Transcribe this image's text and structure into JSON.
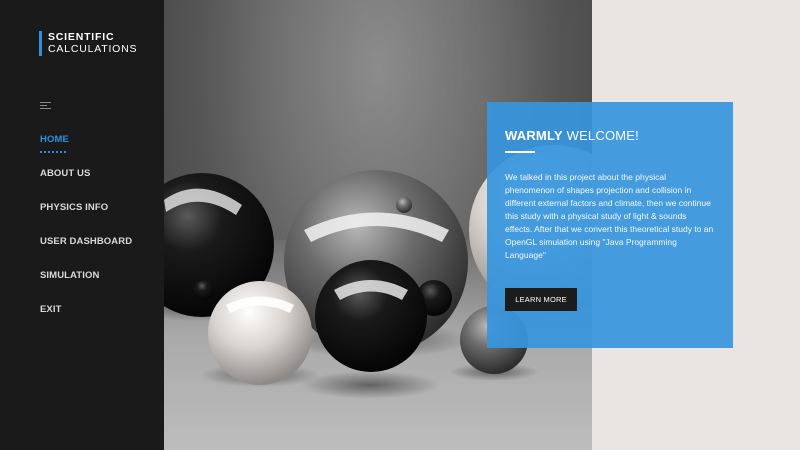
{
  "brand": {
    "line1": "SCIENTIFIC",
    "line2": "CALCULATIONS"
  },
  "nav": {
    "items": [
      {
        "label": "HOME",
        "active": true
      },
      {
        "label": "ABOUT US"
      },
      {
        "label": "PHYSICS INFO"
      },
      {
        "label": "USER DASHBOARD"
      },
      {
        "label": "SIMULATION"
      },
      {
        "label": "EXIT"
      }
    ]
  },
  "welcome": {
    "title_bold": "WARMLY",
    "title_rest": " WELCOME!",
    "body": "We talked in this project about the physical phenomenon of shapes projection and collision in different external factors and climate, then we continue this study with a physical study of light & sounds effects. After that we convert this theoretical study to an OpenGL simulation using \"Java Programming Language\"",
    "button_label": "LEARN MORE"
  },
  "colors": {
    "accent": "#2f8fdd",
    "card": "#3796de",
    "sidebar": "#1a1a1a"
  },
  "icons": {
    "menu": "hamburger-menu-icon"
  }
}
